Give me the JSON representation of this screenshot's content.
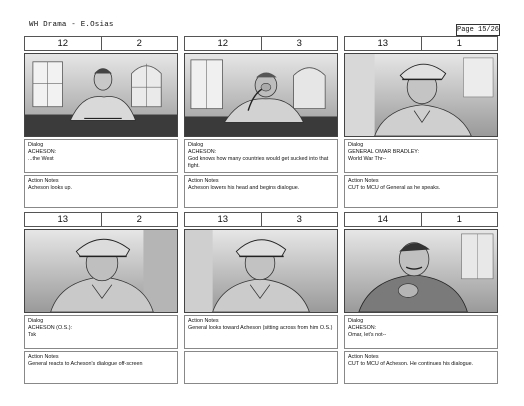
{
  "header": {
    "title": "WH Drama - E.Osias",
    "page": "Page 15/26"
  },
  "panels": [
    {
      "scene": "12",
      "shot": "2",
      "image": "man-seated-at-desk-office",
      "box1": {
        "label": "Dialog",
        "text": "ACHESON:\n...the West"
      },
      "box2": {
        "label": "Action Notes",
        "text": "Acheson looks up."
      }
    },
    {
      "scene": "12",
      "shot": "3",
      "image": "man-head-in-hand-at-desk",
      "box1": {
        "label": "Dialog",
        "text": "ACHESON:\nGod knows how many countries would get sucked into that fight."
      },
      "box2": {
        "label": "Action Notes",
        "text": "Acheson lowers his head and begins dialogue."
      }
    },
    {
      "scene": "13",
      "shot": "1",
      "image": "general-in-cap-medium-close-up",
      "box1": {
        "label": "Dialog",
        "text": "GENERAL OMAR BRADLEY:\nWorld War Thr--"
      },
      "box2": {
        "label": "Action Notes",
        "text": "CUT to MCU of General as he speaks."
      }
    },
    {
      "scene": "13",
      "shot": "2",
      "image": "general-in-cap-close-up",
      "box1": {
        "label": "Dialog",
        "text": "ACHESON (O.S.):\nTsk"
      },
      "box2": {
        "label": "Action Notes",
        "text": "General reacts to Acheson's dialogue off-screen"
      }
    },
    {
      "scene": "13",
      "shot": "3",
      "image": "general-in-cap-looking-across",
      "box1": {
        "label": "Action Notes",
        "text": "General looks toward Acheson (sitting across from him O.S.)"
      },
      "box2": {
        "label": "",
        "text": ""
      }
    },
    {
      "scene": "14",
      "shot": "1",
      "image": "man-with-mustache-hand-at-chin",
      "box1": {
        "label": "Dialog",
        "text": "ACHESON:\nOmar, let's not--"
      },
      "box2": {
        "label": "Action Notes",
        "text": "CUT to MCU of Acheson. He continues his dialogue."
      }
    }
  ]
}
